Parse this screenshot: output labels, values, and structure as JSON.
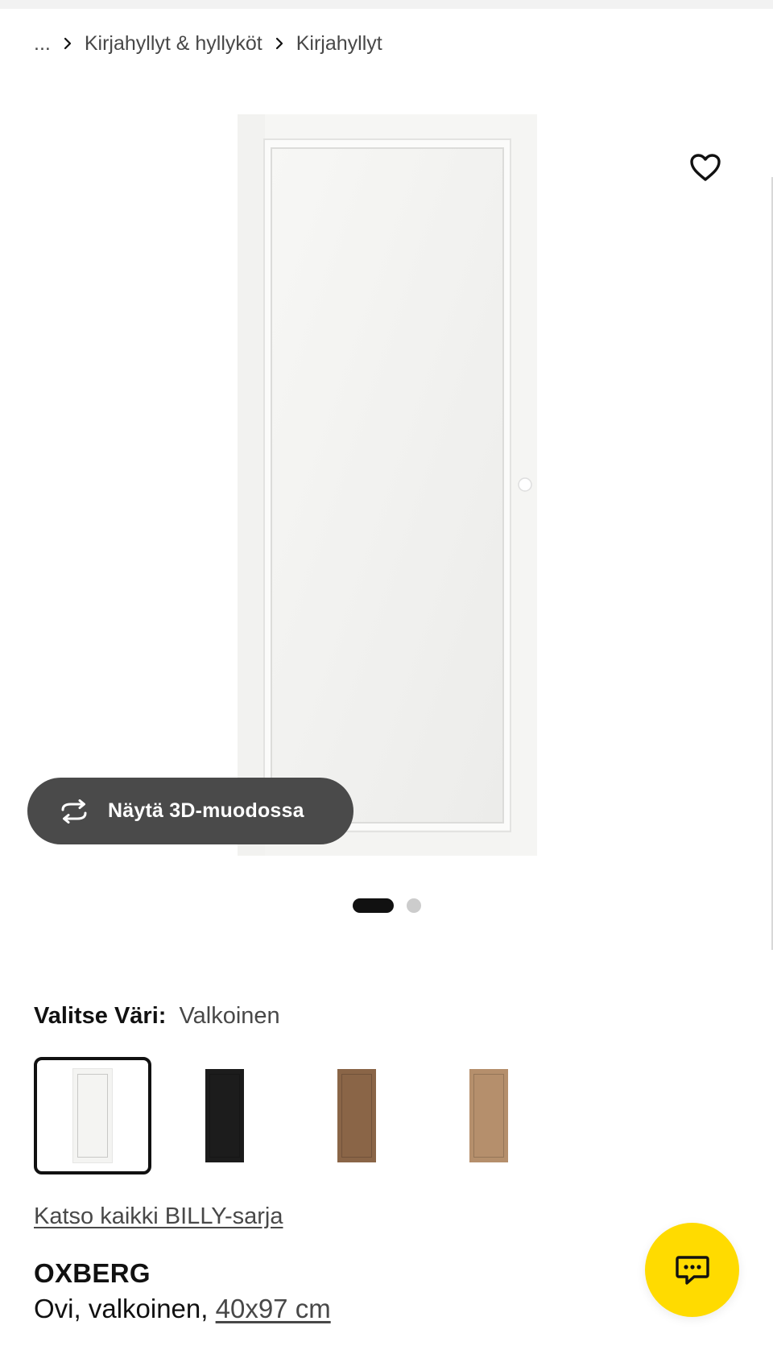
{
  "breadcrumb": {
    "ellipsis": "...",
    "items": [
      "Kirjahyllyt & hyllyköt",
      "Kirjahyllyt"
    ]
  },
  "gallery": {
    "view_3d_label": "Näytä 3D-muodossa",
    "image_count": 2,
    "active_image": 1
  },
  "favorite": {
    "icon": "heart-outline-icon"
  },
  "color_select": {
    "label": "Valitse Väri:",
    "selected_value": "Valkoinen",
    "swatches": [
      {
        "color": "#f4f4f2",
        "selected": true
      },
      {
        "color": "#1c1c1c",
        "selected": false
      },
      {
        "color": "#8a6547",
        "selected": false
      },
      {
        "color": "#b58f6c",
        "selected": false
      }
    ]
  },
  "series_link": "Katso kaikki BILLY-sarja",
  "product": {
    "name": "OXBERG",
    "description": "Ovi, valkoinen, ",
    "size": "40x97 cm"
  },
  "chat": {
    "icon": "chat-bubble-icon"
  },
  "colors": {
    "accent_yellow": "#ffdb00",
    "text_primary": "#111111",
    "text_secondary": "#484848",
    "button_dark": "#4a4a4a"
  }
}
